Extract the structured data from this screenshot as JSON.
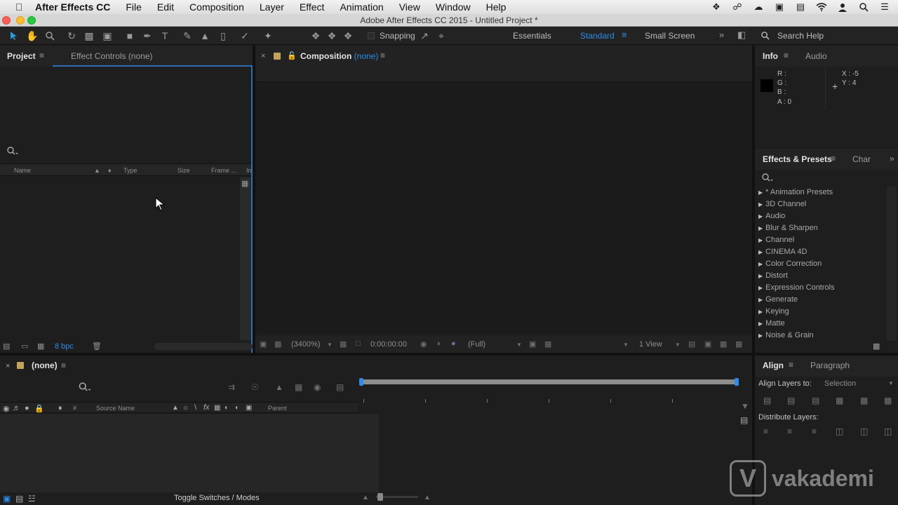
{
  "menubar": {
    "app_name": "After Effects CC",
    "items": [
      "File",
      "Edit",
      "Composition",
      "Layer",
      "Effect",
      "Animation",
      "View",
      "Window",
      "Help"
    ],
    "status_icons": [
      "dropbox-icon",
      "creative-cloud-icon",
      "cloud-icon",
      "screen-mirror-icon",
      "notes-icon",
      "wifi-icon",
      "user-icon",
      "spotlight-search-icon",
      "list-icon"
    ]
  },
  "window": {
    "title": "Adobe After Effects CC 2015 - Untitled Project *"
  },
  "toolbar": {
    "snapping_label": "Snapping",
    "workspaces": [
      "Essentials",
      "Standard",
      "Small Screen"
    ],
    "active_workspace": "Standard",
    "search_help_label": "Search Help"
  },
  "project_panel": {
    "tab_project": "Project",
    "tab_effect_controls": "Effect Controls (none)",
    "columns": [
      "Name",
      "Type",
      "Size",
      "Frame ...",
      "In"
    ],
    "bpc": "8 bpc"
  },
  "composition_panel": {
    "tab_prefix": "Composition",
    "tab_value": "(none)",
    "zoom": "(3400%)",
    "timecode": "0:00:00:00",
    "resolution": "(Full)",
    "view": "1 View"
  },
  "info_panel": {
    "tab_info": "Info",
    "tab_audio": "Audio",
    "r": "R :",
    "g": "G :",
    "b": "B :",
    "a": "A : 0",
    "x": "X : -5",
    "y": "Y : 4"
  },
  "effects_panel": {
    "tab_effects": "Effects & Presets",
    "tab_char": "Char",
    "items": [
      "* Animation Presets",
      "3D Channel",
      "Audio",
      "Blur & Sharpen",
      "Channel",
      "CINEMA 4D",
      "Color Correction",
      "Distort",
      "Expression Controls",
      "Generate",
      "Keying",
      "Matte",
      "Noise & Grain"
    ]
  },
  "timeline_panel": {
    "tab_label": "(none)",
    "columns": [
      "#",
      "Source Name",
      "Parent"
    ],
    "toggle_label": "Toggle Switches / Modes"
  },
  "align_panel": {
    "tab_align": "Align",
    "tab_paragraph": "Paragraph",
    "align_layers_to_label": "Align Layers to:",
    "align_layers_to_value": "Selection",
    "distribute_label": "Distribute Layers:"
  },
  "watermark": {
    "logo_letter": "V",
    "text": "vakademi"
  },
  "colors": {
    "accent": "#2d8ceb",
    "panel_bg": "#1e1e1e"
  }
}
